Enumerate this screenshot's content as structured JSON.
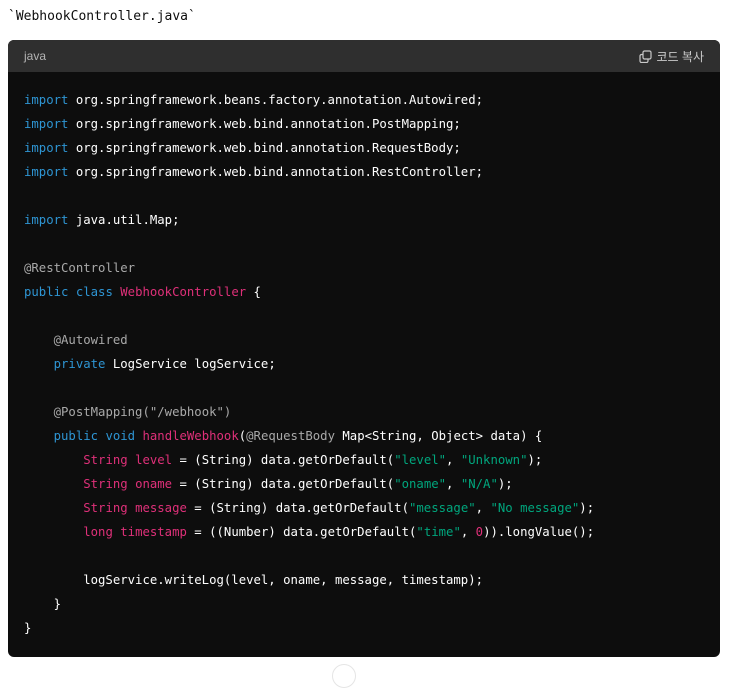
{
  "filename": "`WebhookController.java`",
  "code_block": {
    "language": "java",
    "copy_label": "코드 복사",
    "icons": {
      "copy": "copy-icon"
    },
    "colors": {
      "background": "#0d0d0d",
      "header": "#2f2f2f",
      "keyword": "#2e95d3",
      "annotation": "#a9a9a9",
      "type_name": "#df3079",
      "string": "#00a67d",
      "plain": "#ffffff"
    },
    "lines": [
      [
        {
          "t": "kw",
          "v": "import"
        },
        {
          "t": "pl",
          "v": " org.springframework.beans.factory.annotation.Autowired;"
        }
      ],
      [
        {
          "t": "kw",
          "v": "import"
        },
        {
          "t": "pl",
          "v": " org.springframework.web.bind.annotation.PostMapping;"
        }
      ],
      [
        {
          "t": "kw",
          "v": "import"
        },
        {
          "t": "pl",
          "v": " org.springframework.web.bind.annotation.RequestBody;"
        }
      ],
      [
        {
          "t": "kw",
          "v": "import"
        },
        {
          "t": "pl",
          "v": " org.springframework.web.bind.annotation.RestController;"
        }
      ],
      [],
      [
        {
          "t": "kw",
          "v": "import"
        },
        {
          "t": "pl",
          "v": " java.util.Map;"
        }
      ],
      [],
      [
        {
          "t": "ann",
          "v": "@RestController"
        }
      ],
      [
        {
          "t": "kw",
          "v": "public"
        },
        {
          "t": "pl",
          "v": " "
        },
        {
          "t": "kw",
          "v": "class"
        },
        {
          "t": "pl",
          "v": " "
        },
        {
          "t": "tp",
          "v": "WebhookController"
        },
        {
          "t": "pl",
          "v": " {"
        }
      ],
      [],
      [
        {
          "t": "pl",
          "v": "    "
        },
        {
          "t": "ann",
          "v": "@Autowired"
        }
      ],
      [
        {
          "t": "pl",
          "v": "    "
        },
        {
          "t": "kw",
          "v": "private"
        },
        {
          "t": "pl",
          "v": " LogService logService;"
        }
      ],
      [],
      [
        {
          "t": "pl",
          "v": "    "
        },
        {
          "t": "ann",
          "v": "@PostMapping(\"/webhook\")"
        }
      ],
      [
        {
          "t": "pl",
          "v": "    "
        },
        {
          "t": "kw",
          "v": "public"
        },
        {
          "t": "pl",
          "v": " "
        },
        {
          "t": "kw",
          "v": "void"
        },
        {
          "t": "pl",
          "v": " "
        },
        {
          "t": "tp",
          "v": "handleWebhook"
        },
        {
          "t": "pl",
          "v": "("
        },
        {
          "t": "ann",
          "v": "@RequestBody"
        },
        {
          "t": "pl",
          "v": " Map<String, Object> data) {"
        }
      ],
      [
        {
          "t": "pl",
          "v": "        "
        },
        {
          "t": "tp",
          "v": "String"
        },
        {
          "t": "pl",
          "v": " "
        },
        {
          "t": "tp",
          "v": "level"
        },
        {
          "t": "pl",
          "v": " = (String) data.getOrDefault("
        },
        {
          "t": "str",
          "v": "\"level\""
        },
        {
          "t": "pl",
          "v": ", "
        },
        {
          "t": "str",
          "v": "\"Unknown\""
        },
        {
          "t": "pl",
          "v": ");"
        }
      ],
      [
        {
          "t": "pl",
          "v": "        "
        },
        {
          "t": "tp",
          "v": "String"
        },
        {
          "t": "pl",
          "v": " "
        },
        {
          "t": "tp",
          "v": "oname"
        },
        {
          "t": "pl",
          "v": " = (String) data.getOrDefault("
        },
        {
          "t": "str",
          "v": "\"oname\""
        },
        {
          "t": "pl",
          "v": ", "
        },
        {
          "t": "str",
          "v": "\"N/A\""
        },
        {
          "t": "pl",
          "v": ");"
        }
      ],
      [
        {
          "t": "pl",
          "v": "        "
        },
        {
          "t": "tp",
          "v": "String"
        },
        {
          "t": "pl",
          "v": " "
        },
        {
          "t": "tp",
          "v": "message"
        },
        {
          "t": "pl",
          "v": " = (String) data.getOrDefault("
        },
        {
          "t": "str",
          "v": "\"message\""
        },
        {
          "t": "pl",
          "v": ", "
        },
        {
          "t": "str",
          "v": "\"No message\""
        },
        {
          "t": "pl",
          "v": ");"
        }
      ],
      [
        {
          "t": "pl",
          "v": "        "
        },
        {
          "t": "tp",
          "v": "long"
        },
        {
          "t": "pl",
          "v": " "
        },
        {
          "t": "tp",
          "v": "timestamp"
        },
        {
          "t": "pl",
          "v": " = ((Number) data.getOrDefault("
        },
        {
          "t": "str",
          "v": "\"time\""
        },
        {
          "t": "pl",
          "v": ", "
        },
        {
          "t": "num",
          "v": "0"
        },
        {
          "t": "pl",
          "v": ")).longValue();"
        }
      ],
      [],
      [
        {
          "t": "pl",
          "v": "        logService.writeLog(level, oname, message, timestamp);"
        }
      ],
      [
        {
          "t": "pl",
          "v": "    }"
        }
      ],
      [
        {
          "t": "pl",
          "v": "}"
        }
      ]
    ]
  }
}
